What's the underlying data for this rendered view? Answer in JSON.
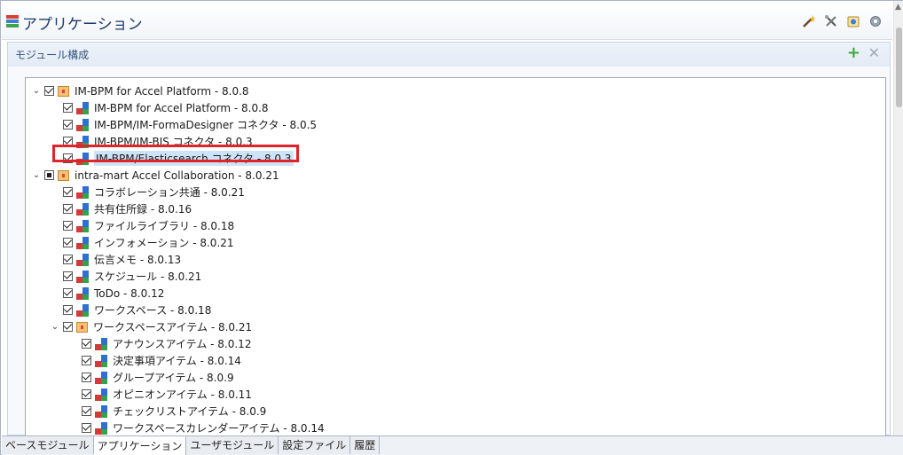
{
  "window": {
    "title": "アプリケーション",
    "toolbar_icons": [
      "magic-wand-icon",
      "tools-icon",
      "info-icon",
      "settings-icon"
    ]
  },
  "section": {
    "title": "モジュール構成",
    "add_icon": "plus-icon",
    "remove_icon": "close-icon"
  },
  "tree": {
    "rows": [
      {
        "label": "IM-BPM for Accel Platform - 8.0.8",
        "level": 0,
        "toggle": "expanded",
        "check": "checked",
        "icon": "package"
      },
      {
        "label": "IM-BPM for Accel Platform - 8.0.8",
        "level": 1,
        "toggle": "none",
        "check": "checked",
        "icon": "module"
      },
      {
        "label": "IM-BPM/IM-FormaDesigner コネクタ - 8.0.5",
        "level": 1,
        "toggle": "none",
        "check": "checked",
        "icon": "module"
      },
      {
        "label": "IM-BPM/IM-BIS コネクタ - 8.0.3",
        "level": 1,
        "toggle": "none",
        "check": "checked",
        "icon": "module"
      },
      {
        "label": "IM-BPM/Elasticsearch コネクタ - 8.0.3",
        "level": 1,
        "toggle": "none",
        "check": "checked",
        "icon": "module",
        "selected": true
      },
      {
        "label": "intra-mart Accel Collaboration - 8.0.21",
        "level": 0,
        "toggle": "expanded",
        "check": "partial",
        "icon": "package"
      },
      {
        "label": "コラボレーション共通 - 8.0.21",
        "level": 1,
        "toggle": "none",
        "check": "checked",
        "icon": "module"
      },
      {
        "label": "共有住所録 - 8.0.16",
        "level": 1,
        "toggle": "none",
        "check": "checked",
        "icon": "module"
      },
      {
        "label": "ファイルライブラリ - 8.0.18",
        "level": 1,
        "toggle": "none",
        "check": "checked",
        "icon": "module"
      },
      {
        "label": "インフォメーション - 8.0.21",
        "level": 1,
        "toggle": "none",
        "check": "checked",
        "icon": "module"
      },
      {
        "label": "伝言メモ - 8.0.13",
        "level": 1,
        "toggle": "none",
        "check": "checked",
        "icon": "module"
      },
      {
        "label": "スケジュール - 8.0.21",
        "level": 1,
        "toggle": "none",
        "check": "checked",
        "icon": "module"
      },
      {
        "label": "ToDo - 8.0.12",
        "level": 1,
        "toggle": "none",
        "check": "checked",
        "icon": "module"
      },
      {
        "label": "ワークスペース - 8.0.18",
        "level": 1,
        "toggle": "none",
        "check": "checked",
        "icon": "module"
      },
      {
        "label": "ワークスペースアイテム - 8.0.21",
        "level": 1,
        "toggle": "expanded",
        "check": "checked",
        "icon": "package"
      },
      {
        "label": "アナウンスアイテム - 8.0.12",
        "level": 2,
        "toggle": "none",
        "check": "checked",
        "icon": "module"
      },
      {
        "label": "決定事項アイテム - 8.0.14",
        "level": 2,
        "toggle": "none",
        "check": "checked",
        "icon": "module"
      },
      {
        "label": "グループアイテム - 8.0.9",
        "level": 2,
        "toggle": "none",
        "check": "checked",
        "icon": "module"
      },
      {
        "label": "オピニオンアイテム - 8.0.11",
        "level": 2,
        "toggle": "none",
        "check": "checked",
        "icon": "module"
      },
      {
        "label": "チェックリストアイテム - 8.0.9",
        "level": 2,
        "toggle": "none",
        "check": "checked",
        "icon": "module"
      },
      {
        "label": "ワークスペースカレンダーアイテム - 8.0.14",
        "level": 2,
        "toggle": "none",
        "check": "checked",
        "icon": "module"
      }
    ]
  },
  "tabs": [
    {
      "label": "ベースモジュール",
      "active": false
    },
    {
      "label": "アプリケーション",
      "active": true
    },
    {
      "label": "ユーザモジュール",
      "active": false
    },
    {
      "label": "設定ファイル",
      "active": false
    },
    {
      "label": "履歴",
      "active": false
    }
  ],
  "colors": {
    "highlight_border": "#e0252a",
    "title_text": "#1d3b6b",
    "selection": "#cde3f7"
  }
}
